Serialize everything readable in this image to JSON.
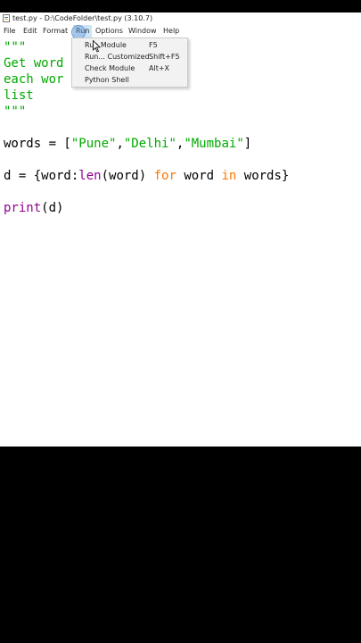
{
  "window": {
    "title": "test.py - D:\\CodeFolder\\test.py (3.10.7)"
  },
  "menubar": {
    "items": [
      {
        "label": "File"
      },
      {
        "label": "Edit"
      },
      {
        "label": "Format"
      },
      {
        "label": "Run"
      },
      {
        "label": "Options"
      },
      {
        "label": "Window"
      },
      {
        "label": "Help"
      }
    ],
    "active": "Run"
  },
  "editor": {
    "lines": [
      {
        "text": "\"\"\"",
        "color": "green"
      },
      {
        "text": "Get word",
        "color": "green"
      },
      {
        "text": "each wor",
        "color": "green"
      },
      {
        "text": "list",
        "color": "green"
      },
      {
        "text": "\"\"\"",
        "color": "green"
      }
    ],
    "words_line": {
      "lhs": "words = [",
      "s1": "\"Pune\"",
      "c1": ",",
      "s2": "\"Delhi\"",
      "c2": ",",
      "s3": "\"Mumbai\"",
      "end": "]"
    },
    "dict_line": {
      "a": "d = {word:",
      "len": "len",
      "b": "(word) ",
      "for": "for",
      "c": " word ",
      "in": "in",
      "d": " words}"
    },
    "print_line": {
      "print": "print",
      "rest": "(d)"
    }
  },
  "run_menu": {
    "items": [
      {
        "label": "Run Module",
        "shortcut": "F5"
      },
      {
        "label": "Run... Customized",
        "shortcut": "Shift+F5"
      },
      {
        "label": "Check Module",
        "shortcut": "Alt+X"
      },
      {
        "label": "Python Shell",
        "shortcut": ""
      }
    ]
  },
  "colors": {
    "string": "#00aa00",
    "keyword": "#ff7700",
    "builtin": "#900090",
    "menu_highlight": "#cce4f7"
  }
}
